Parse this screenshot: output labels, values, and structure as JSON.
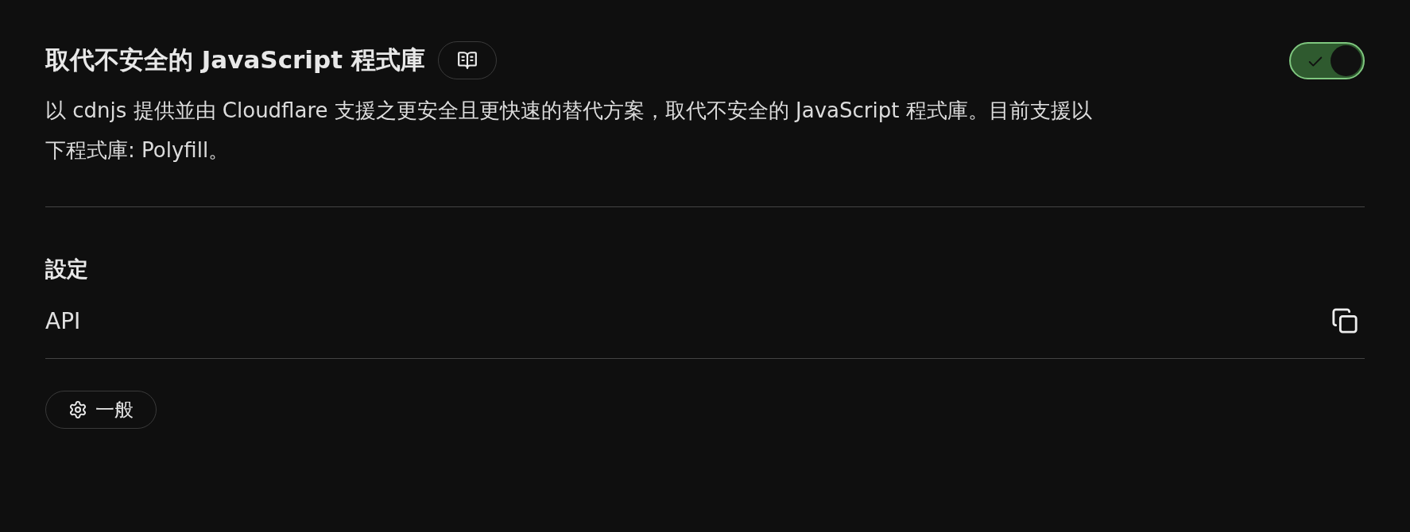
{
  "header": {
    "title": "取代不安全的 JavaScript 程式庫",
    "toggle": {
      "on": true
    }
  },
  "description": "以 cdnjs 提供並由 Cloudflare 支援之更安全且更快速的替代方案，取代不安全的 JavaScript 程式庫。目前支援以下程式庫: Polyfill。",
  "settings": {
    "heading": "設定",
    "rows": [
      {
        "label": "API"
      }
    ]
  },
  "tags": [
    {
      "label": "一般"
    }
  ]
}
